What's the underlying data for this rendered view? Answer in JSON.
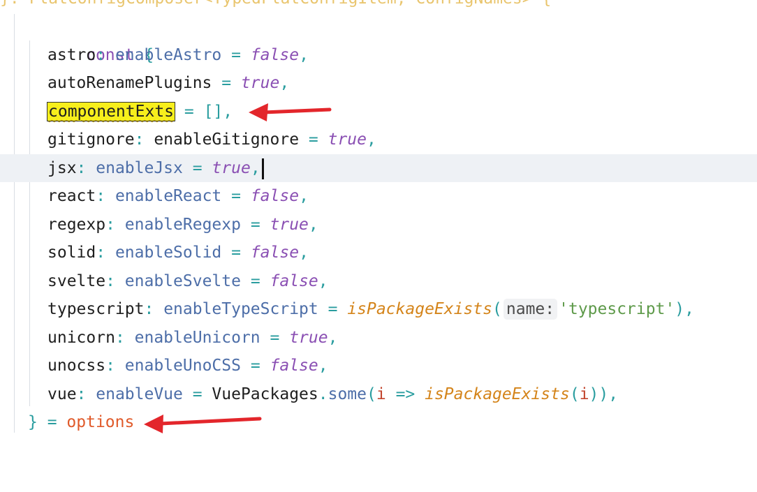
{
  "editor": {
    "line0": {
      "text": "}: FlatConfigComposer<TypedFlatConfigItem, ConfigNames> {"
    },
    "line1": {
      "kw": "const",
      "brace": " {"
    },
    "lines": [
      {
        "prop": "astro",
        "sep": ": ",
        "local": "enableAstro",
        "eq": " = ",
        "val": "false",
        "tail": ","
      },
      {
        "prop": "autoRenamePlugins",
        "eq": " = ",
        "val": "true",
        "tail": ","
      },
      {
        "prop": "componentExts",
        "eq": " = ",
        "val": "[]",
        "tail": ","
      },
      {
        "prop": "gitignore",
        "sep": ": ",
        "local": "enableGitignore",
        "eq": " = ",
        "val": "true",
        "tail": ","
      },
      {
        "prop": "jsx",
        "sep": ": ",
        "local": "enableJsx",
        "eq": " = ",
        "val": "true",
        "tail": ","
      },
      {
        "prop": "react",
        "sep": ": ",
        "local": "enableReact",
        "eq": " = ",
        "val": "false",
        "tail": ","
      },
      {
        "prop": "regexp",
        "sep": ": ",
        "local": "enableRegexp",
        "eq": " = ",
        "val": "true",
        "tail": ","
      },
      {
        "prop": "solid",
        "sep": ": ",
        "local": "enableSolid",
        "eq": " = ",
        "val": "false",
        "tail": ","
      },
      {
        "prop": "svelte",
        "sep": ": ",
        "local": "enableSvelte",
        "eq": " = ",
        "val": "false",
        "tail": ","
      }
    ],
    "typescript": {
      "prop": "typescript",
      "sep": ": ",
      "local": "enableTypeScript",
      "eq": " = ",
      "fn": "isPackageExists",
      "open": "(",
      "hint": "name:",
      "str": "'typescript'",
      "close": "),"
    },
    "unicorn": {
      "prop": "unicorn",
      "sep": ": ",
      "local": "enableUnicorn",
      "eq": " = ",
      "val": "true",
      "tail": ","
    },
    "unocss": {
      "prop": "unocss",
      "sep": ": ",
      "local": "enableUnoCSS",
      "eq": " = ",
      "val": "false",
      "tail": ","
    },
    "vue": {
      "prop": "vue",
      "sep": ": ",
      "local": "enableVue",
      "eq": " = ",
      "cls": "VuePackages",
      "dot": ".",
      "method": "some",
      "p1": "(",
      "param": "i",
      "arrow": " => ",
      "fn": "isPackageExists",
      "p2": "(",
      "param2": "i",
      "close": ")),"
    },
    "last": {
      "brace": "}",
      "eq": " = ",
      "opts": "options"
    }
  },
  "colors": {
    "arrow": "#e3262b",
    "highlight": "#f7ef1c"
  }
}
